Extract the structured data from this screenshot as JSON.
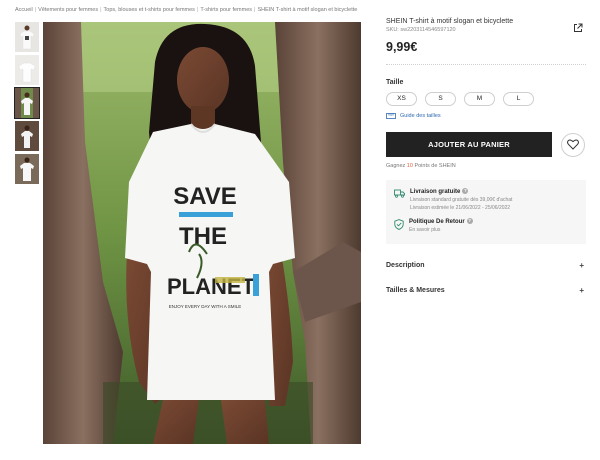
{
  "breadcrumb": [
    "Accueil",
    "Vêtements pour femmes",
    "Tops, blouses et t-shirts pour femmes",
    "T-shirts pour femmes",
    "SHEIN T-shirt à motif slogan et bicyclette"
  ],
  "product": {
    "title": "SHEIN T-shirt à motif slogan et bicyclette",
    "sku": "SKU: sw2203114546597120",
    "price": "9,99€"
  },
  "sizes": {
    "title": "Taille",
    "options": [
      "XS",
      "S",
      "M",
      "L"
    ],
    "guide_label": "Guide des tailles"
  },
  "cart": {
    "add_label": "AJOUTER AU PANIER"
  },
  "points": {
    "prefix": "Gagnez",
    "number": "10",
    "suffix": "Points de SHEIN"
  },
  "shipping": {
    "free": {
      "title": "Livraison gratuite",
      "line1": "Livraison standard gratuite dès 39,00€ d'achat",
      "line2": "Livraison estimée le 21/06/2022 - 25/06/2022"
    },
    "returns": {
      "title": "Politique De Retour",
      "link": "En savoir plus"
    }
  },
  "accordions": {
    "description": "Description",
    "sizes_measures": "Tailles & Mesures",
    "expand_symbol": "+"
  },
  "shirt_print": {
    "line1": "SAVE",
    "line2": "THE",
    "line3": "PLANET",
    "small": "ENJOY EVERY DAY WITH A SMILE"
  },
  "colors": {
    "accent_points": "#e0603a",
    "link_blue": "#2f6ab0",
    "button_dark": "#222222",
    "ship_green": "#2d8a6e"
  }
}
